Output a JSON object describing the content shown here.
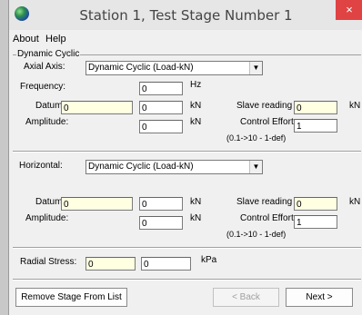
{
  "window": {
    "title": "Station 1, Test Stage Number 1",
    "close_glyph": "×"
  },
  "menu": {
    "about": "About",
    "help": "Help"
  },
  "dynamic": {
    "group_label": "Dynamic Cyclic",
    "axial_axis_label": "Axial Axis:",
    "axial_axis_value": "Dynamic Cyclic (Load-kN)",
    "frequency_label": "Frequency:",
    "frequency_value": "0",
    "frequency_unit": "Hz",
    "datum_label": "Datum:",
    "datum_value_1": "0",
    "datum_value_2": "0",
    "datum_unit": "kN",
    "slave_label": "Slave reading",
    "slave_value": "0",
    "slave_unit": "kN",
    "amplitude_label": "Amplitude:",
    "amplitude_value": "0",
    "amplitude_unit": "kN",
    "control_effort_label": "Control Effort",
    "control_effort_value": "1",
    "control_effort_hint": "(0.1->10 - 1-def)"
  },
  "horizontal": {
    "label": "Horizontal:",
    "mode_value": "Dynamic Cyclic (Load-kN)",
    "datum_label": "Datum:",
    "datum_value_1": "0",
    "datum_value_2": "0",
    "datum_unit": "kN",
    "slave_label": "Slave reading",
    "slave_value": "0",
    "slave_unit": "kN",
    "amplitude_label": "Amplitude:",
    "amplitude_value": "0",
    "amplitude_unit": "kN",
    "control_effort_label": "Control Effort",
    "control_effort_value": "1",
    "control_effort_hint": "(0.1->10 - 1-def)"
  },
  "radial": {
    "label": "Radial Stress:",
    "value_1": "0",
    "value_2": "0",
    "unit": "kPa"
  },
  "buttons": {
    "remove": "Remove Stage From List",
    "back": "< Back",
    "next": "Next >"
  }
}
